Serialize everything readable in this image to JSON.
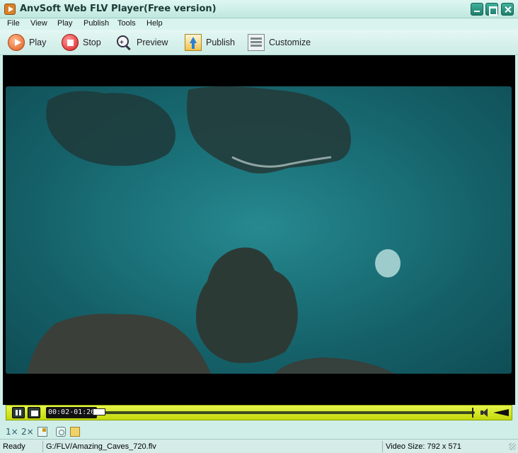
{
  "window": {
    "title": "AnvSoft Web FLV Player(Free version)",
    "icon": "app-play-icon"
  },
  "menu": [
    "File",
    "View",
    "Play",
    "Publish",
    "Tools",
    "Help"
  ],
  "toolbar": {
    "play_label": "Play",
    "stop_label": "Stop",
    "preview_label": "Preview",
    "publish_label": "Publish",
    "customize_label": "Customize"
  },
  "player": {
    "time_display": "00:02-01:26",
    "control_bar_color": "#d4e81a",
    "controls": [
      "pause-icon",
      "fullscreen-icon",
      "speaker-icon",
      "volume-icon"
    ]
  },
  "bottom": {
    "zoom_1x": "1×",
    "zoom_2x": "2×"
  },
  "status": {
    "state": "Ready",
    "file_path": "G:/FLV/Amazing_Caves_720.flv",
    "video_size": "Video Size: 792 x 571"
  },
  "colors": {
    "window_bg": "#cfeee8",
    "accent": "#1f7f6c"
  }
}
